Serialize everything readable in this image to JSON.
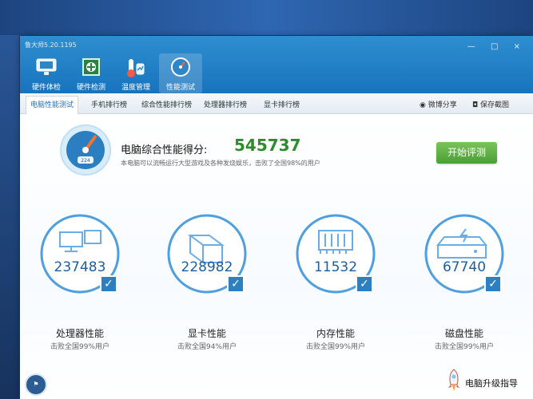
{
  "app": {
    "title": "鲁大师5.20.1195",
    "window_controls": "— □ ×"
  },
  "nav": [
    {
      "label": "硬件体检",
      "icon": "monitor-icon"
    },
    {
      "label": "硬件检测",
      "icon": "chip-icon"
    },
    {
      "label": "温度管理",
      "icon": "thermometer-icon"
    },
    {
      "label": "性能测试",
      "icon": "gauge-icon"
    }
  ],
  "tabs": [
    "电脑性能测试",
    "手机排行榜",
    "综合性能排行榜",
    "处理器排行榜",
    "显卡排行榜"
  ],
  "tab_actions": {
    "share": "微博分享",
    "save": "保存截图"
  },
  "summary": {
    "title": "电脑综合性能得分:",
    "score": "545737",
    "subtitle": "本电脑可以流畅运行大型游戏及各种发烧娱乐，击败了全国98%的用户",
    "button": "开始评测",
    "gauge_label": "224"
  },
  "cards": [
    {
      "score": "237483",
      "title": "处理器性能",
      "subtitle": "击败全国99%用户"
    },
    {
      "score": "228982",
      "title": "显卡性能",
      "subtitle": "击败全国94%用户"
    },
    {
      "score": "11532",
      "title": "内存性能",
      "subtitle": "击败全国99%用户"
    },
    {
      "score": "67740",
      "title": "磁盘性能",
      "subtitle": "击败全国99%用户"
    }
  ],
  "bottom": {
    "upgrade": "电脑升级指导"
  },
  "colors": {
    "header_blue": "#1873bd",
    "accent_green": "#4a9f34",
    "score_green": "#2e8b2e",
    "ring_blue": "#4d9fe0"
  }
}
